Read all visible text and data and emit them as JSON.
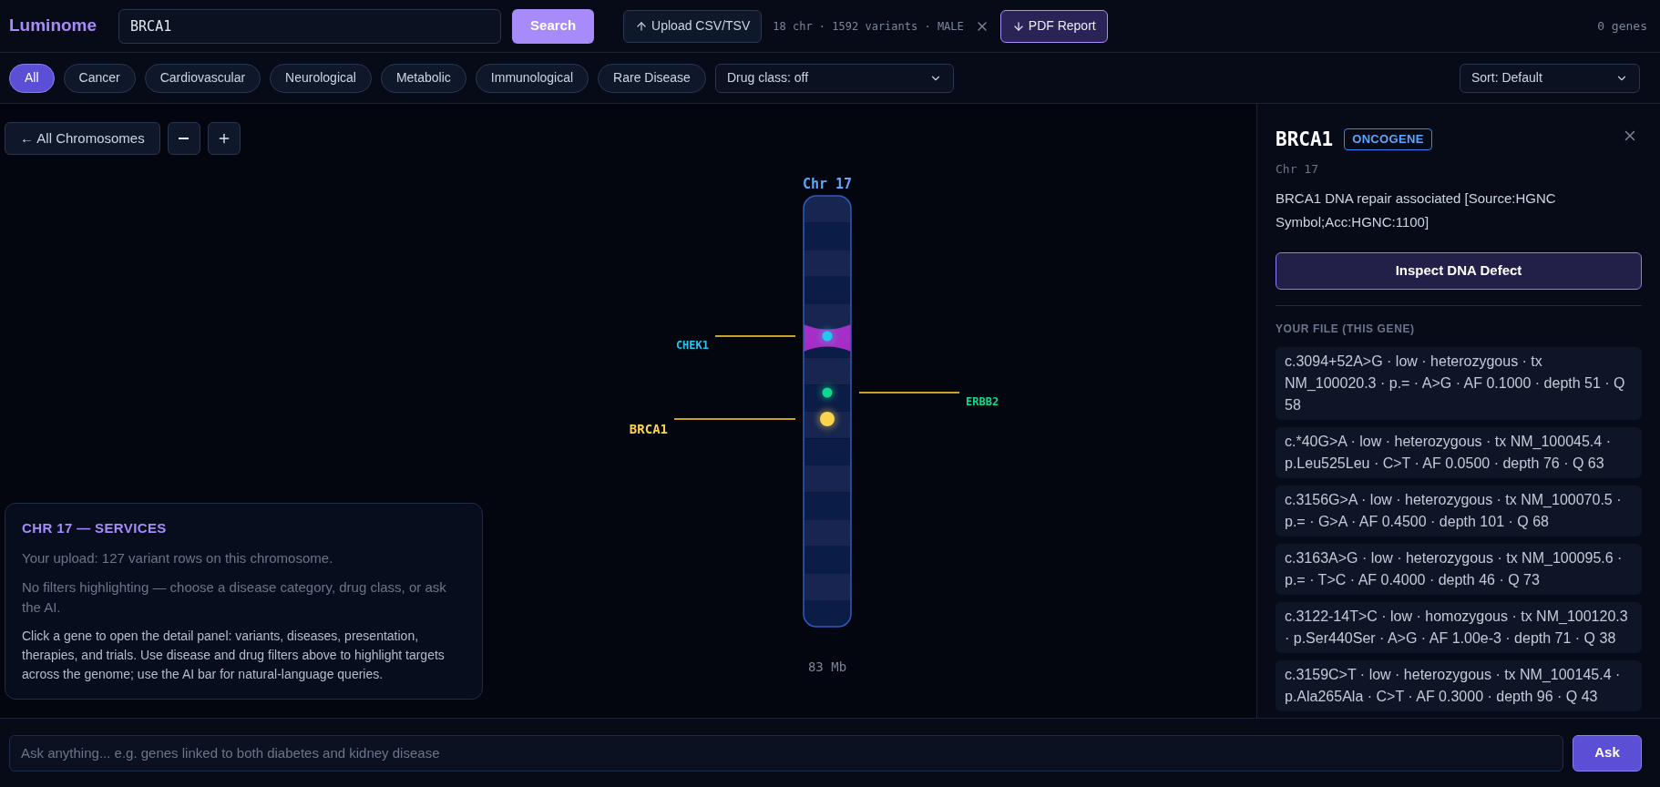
{
  "header": {
    "logo": "Luminome",
    "search": {
      "value": "BRCA1"
    },
    "search_button": "Search",
    "upload_button": "Upload CSV/TSV",
    "file_status": "18 chr · 1592 variants · MALE",
    "pdf_button": "PDF Report",
    "gene_count": "0 genes"
  },
  "filters": [
    {
      "label": "All",
      "selected": true
    },
    {
      "label": "Cancer",
      "selected": false
    },
    {
      "label": "Cardiovascular",
      "selected": false
    },
    {
      "label": "Neurological",
      "selected": false
    },
    {
      "label": "Metabolic",
      "selected": false
    },
    {
      "label": "Immunological",
      "selected": false
    },
    {
      "label": "Rare Disease",
      "selected": false
    }
  ],
  "drug_class_select": "Drug class: off",
  "sort_select": "Sort: Default",
  "view_toolbar": {
    "back_button": "← All Chromosomes"
  },
  "chromosome": {
    "label": "Chr 17",
    "length": "83 Mb",
    "genes": [
      {
        "name": "CHEK1",
        "color": "#22c8f0",
        "selected": false,
        "kind": "left"
      },
      {
        "name": "ERBB2",
        "color": "#10d98f",
        "selected": false,
        "kind": "right"
      },
      {
        "name": "BRCA1",
        "color": "#fcd34d",
        "selected": true,
        "kind": "left"
      }
    ]
  },
  "services_card": {
    "title": "CHR 17 — SERVICES",
    "upload_note": "Your upload: 127 variant rows on this chromosome.",
    "filter_note": "No filters highlighting — choose a disease category, drug class, or ask the AI.",
    "help": "Click a gene to open the detail panel: variants, diseases, presentation, therapies, and trials. Use disease and drug filters above to highlight targets across the genome; use the AI bar for natural-language queries."
  },
  "detail_panel": {
    "gene": "BRCA1",
    "badge": "ONCOGENE",
    "chromosome": "Chr 17",
    "description": "BRCA1 DNA repair associated [Source:HGNC Symbol;Acc:HGNC:1100]",
    "inspect_button": "Inspect DNA Defect",
    "section_title": "YOUR FILE (THIS GENE)",
    "variants": [
      "c.3094+52A>G · low · heterozygous · tx NM_100020.3 · p.= · A>G · AF 0.1000 · depth 51 · Q 58",
      "c.*40G>A · low · heterozygous · tx NM_100045.4 · p.Leu525Leu · C>T · AF 0.0500 · depth 76 · Q 63",
      "c.3156G>A · low · heterozygous · tx NM_100070.5 · p.= · G>A · AF 0.4500 · depth 101 · Q 68",
      "c.3163A>G · low · heterozygous · tx NM_100095.6 · p.= · T>C · AF 0.4000 · depth 46 · Q 73",
      "c.3122-14T>C · low · homozygous · tx NM_100120.3 · p.Ser440Ser · A>G · AF 1.00e-3 · depth 71 · Q 38",
      "c.3159C>T · low · heterozygous · tx NM_100145.4 · p.Ala265Ala · C>T · AF 0.3000 · depth 96 · Q 43"
    ]
  },
  "ask_bar": {
    "placeholder": "Ask anything... e.g. genes linked to both diabetes and kidney disease",
    "button": "Ask"
  }
}
